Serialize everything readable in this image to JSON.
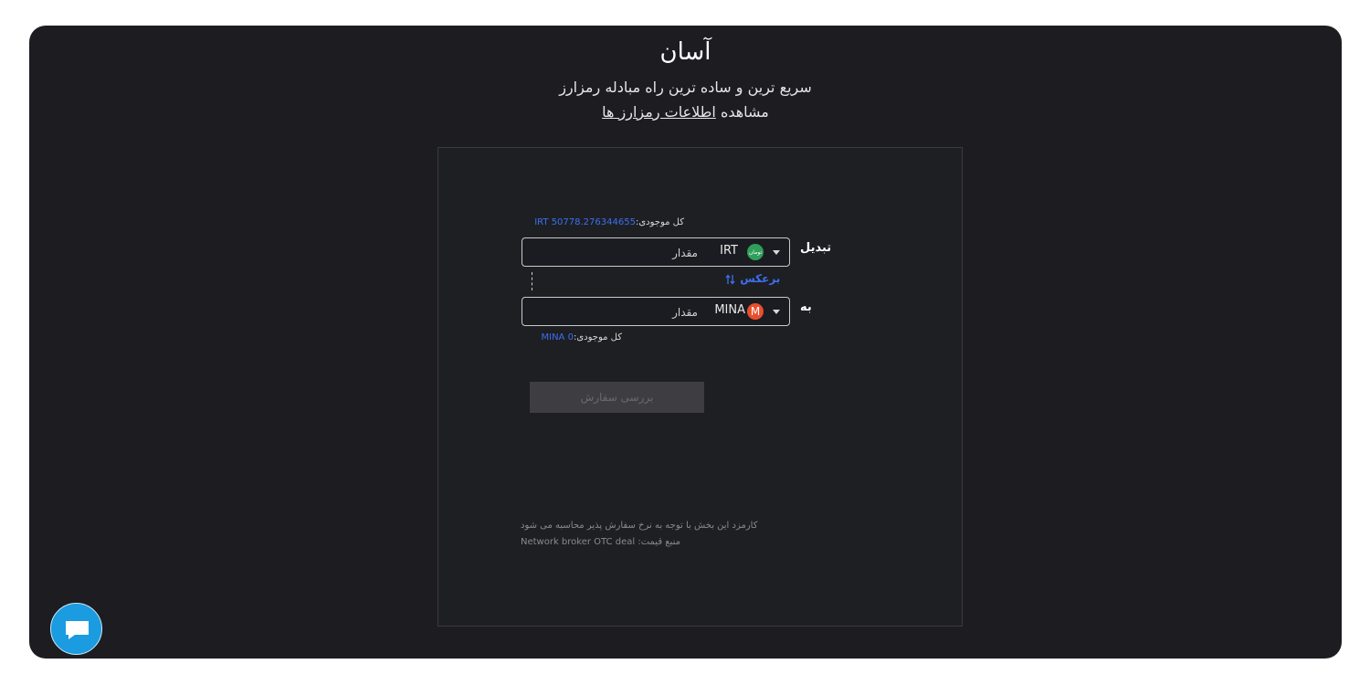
{
  "header": {
    "title": "آسان",
    "subtitle": "سریع ترین و ساده ترین راه مبادله رمزارز",
    "info_prefix": "مشاهده",
    "info_link": "اطلاعات رمزارز ها"
  },
  "exchange": {
    "from": {
      "balance_label": "کل موجودی:",
      "balance_value": "IRT 50778.276344655",
      "label": "تبدیل",
      "coin_symbol": "IRT",
      "coin_icon_text": "تومان",
      "coin_icon_color": "#2f9e5b",
      "amount_placeholder": "مقدار"
    },
    "reverse_label": "برعکس",
    "to": {
      "label": "به",
      "coin_symbol": "MINA",
      "coin_icon_text": "M",
      "coin_icon_color": "#e84f2c",
      "amount_placeholder": "مقدار",
      "balance_label": "کل موجودی:",
      "balance_value": "MINA 0"
    },
    "submit_label": "بررسی سفارش"
  },
  "notes": {
    "fee": "کارمزد این بخش با توجه به نرخ سفارش پذیر محاسبه می شود",
    "price_source_label": "منبع قیمت:",
    "price_source_value": "Network broker OTC deal"
  },
  "colors": {
    "background": "#1c1c21",
    "accent": "#3d6ff0",
    "chat_button": "#1b9be0"
  },
  "icons": {
    "chat": "chat-bubble-icon",
    "dropdown": "chevron-down-icon",
    "swap": "swap-arrows-icon"
  }
}
